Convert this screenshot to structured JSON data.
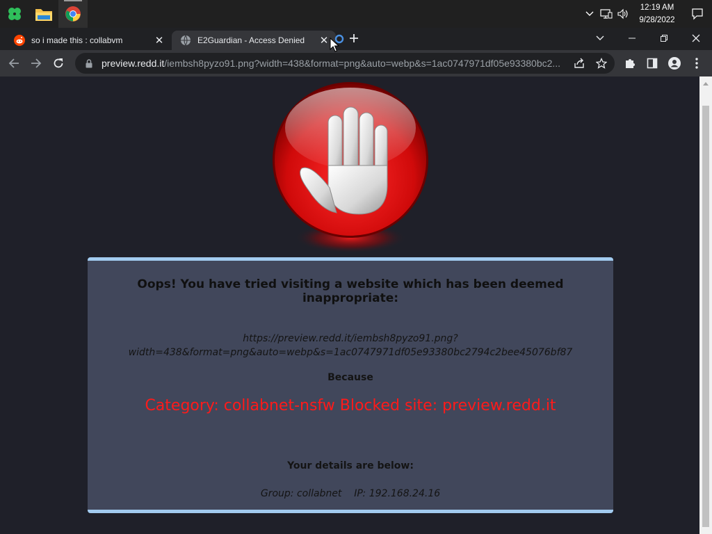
{
  "taskbar": {
    "apps": [
      {
        "name": "start",
        "icon": "clover-icon"
      },
      {
        "name": "file-explorer",
        "icon": "folder-icon"
      },
      {
        "name": "chrome",
        "icon": "chrome-icon"
      }
    ],
    "clock": {
      "time": "12:19 AM",
      "date": "9/28/2022"
    }
  },
  "browser": {
    "tabs": [
      {
        "title": "so i made this : collabvm",
        "favicon": "reddit-icon",
        "active": false
      },
      {
        "title": "E2Guardian - Access Denied",
        "favicon": "globe-icon",
        "active": true
      }
    ],
    "url_host": "preview.redd.it",
    "url_rest": "/iembsh8pyzo91.png?width=438&format=png&auto=webp&s=1ac0747971df05e93380bc2..."
  },
  "page": {
    "heading": "Oops! You have tried visiting a website which has been deemed inappropriate:",
    "blocked_url_line1": "https://preview.redd.it/iembsh8pyzo91.png?",
    "blocked_url_line2": "width=438&format=png&auto=webp&s=1ac0747971df05e93380bc2794c2bee45076bf87",
    "because": "Because",
    "reason": "Category: collabnet-nsfw  Blocked site: preview.redd.it",
    "details_heading": "Your details are below:",
    "group_ip": "Group: collabnet    IP: 192.168.24.16"
  },
  "colors": {
    "panel_bg": "#41475b",
    "panel_border": "#a2cbef",
    "reason_text": "#ff1a1a",
    "page_bg": "#1f2029"
  }
}
